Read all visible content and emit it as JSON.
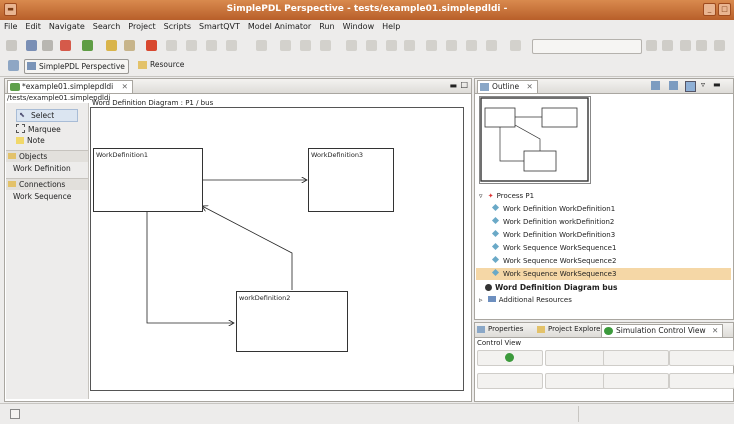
{
  "window": {
    "title": "SimplePDL Perspective - tests/example01.simplepdldi -"
  },
  "menu": [
    "File",
    "Edit",
    "Navigate",
    "Search",
    "Project",
    "Scripts",
    "SmartQVT",
    "Model Animator",
    "Run",
    "Window",
    "Help"
  ],
  "perspectives": {
    "active": "SimplePDL Perspective",
    "other": "Resource"
  },
  "editor": {
    "tab": "*example01.simplepdldi",
    "path": "/tests/example01.simplepdldi",
    "diagram_title": "Word Definition Diagram : P1 / bus"
  },
  "palette": {
    "tools": [
      "Select",
      "Marquee",
      "Note"
    ],
    "groups": [
      {
        "label": "Objects",
        "items": [
          "Work Definition"
        ]
      },
      {
        "label": "Connections",
        "items": [
          "Work Sequence"
        ]
      }
    ]
  },
  "diagram": {
    "nodes": [
      "WorkDefinition1",
      "WorkDefinition3",
      "workDefinition2"
    ]
  },
  "outline": {
    "tab": "Outline",
    "root": "Process P1",
    "children": [
      "Work Definition WorkDefinition1",
      "Work Definition workDefinition2",
      "Work Definition WorkDefinition3",
      "Work Sequence WorkSequence1",
      "Work Sequence WorkSequence2",
      "Work Sequence WorkSequence3"
    ],
    "selected": "Work Sequence WorkSequence3",
    "diagram_item": "Word Definition Diagram bus",
    "additional": "Additional Resources"
  },
  "bottom": {
    "tabs": [
      "Properties",
      "Project Explorer",
      "Simulation Control View"
    ],
    "control_view_label": "Control View"
  },
  "colors": {
    "titlebar": "#c9733a",
    "selection": "#f5d7a6",
    "accent": "#2e8b57"
  }
}
